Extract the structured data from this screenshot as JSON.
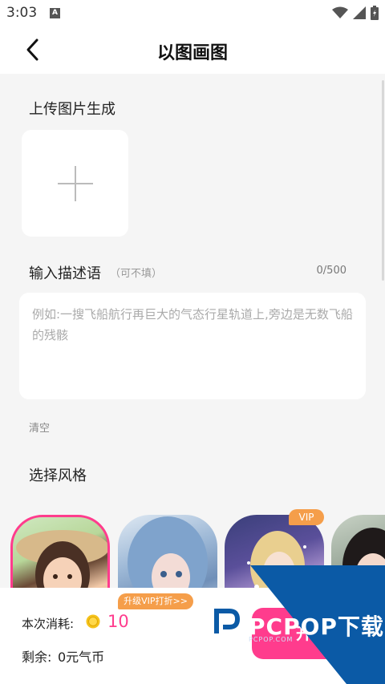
{
  "status": {
    "time": "3:03",
    "app_badge": "A"
  },
  "header": {
    "title": "以图画图"
  },
  "upload": {
    "title": "上传图片生成"
  },
  "description": {
    "title": "输入描述语",
    "optional_hint": "（可不填）",
    "counter": "0/500",
    "placeholder": "例如:一搜飞船航行再巨大的气态行星轨道上,旁边是无数飞船的残骸",
    "clear_label": "清空"
  },
  "styles": {
    "title": "选择风格",
    "vip_tag": "VIP"
  },
  "bottom": {
    "upgrade_badge": "升级VIP打折>>",
    "cost_label": "本次消耗:",
    "cost_value": "10",
    "balance_label": "剩余:",
    "balance_value": "0元气币",
    "start_label": "开始"
  },
  "watermark": {
    "text": "PCPOP下载",
    "subtext": "PCPOP.COM"
  },
  "colors": {
    "accent": "#ff3c8d",
    "badge": "#f59e4a",
    "watermark": "#0b5aa6"
  }
}
